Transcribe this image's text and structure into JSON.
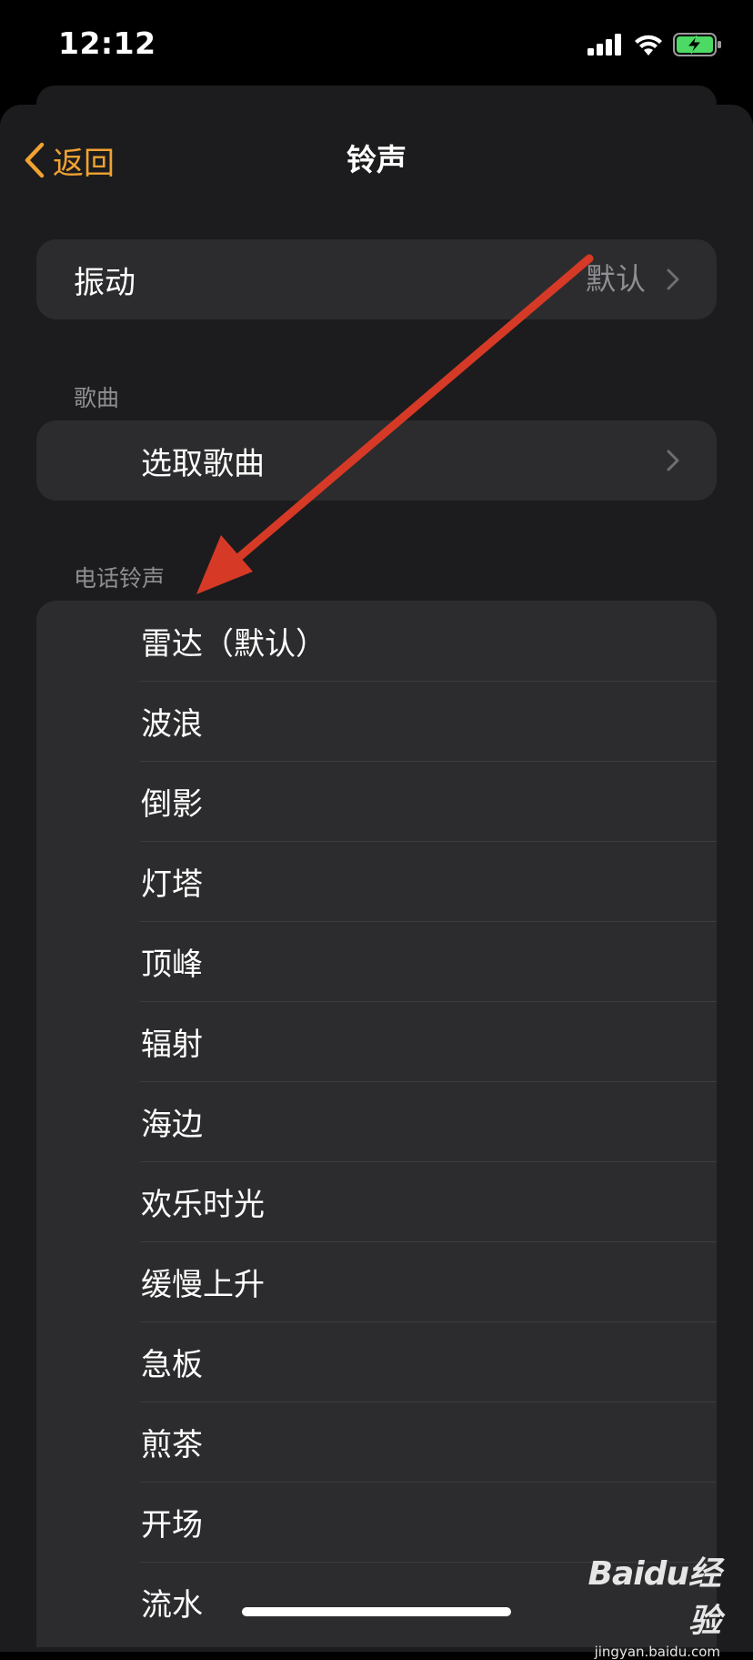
{
  "status_bar": {
    "time": "12:12",
    "signal_icon": "cellular-signal-icon",
    "wifi_icon": "wifi-icon",
    "battery_icon": "battery-charging-icon",
    "battery_color": "#4cd964"
  },
  "nav": {
    "back_label": "返回",
    "title": "铃声",
    "accent_color": "#f0a232"
  },
  "vibration": {
    "label": "振动",
    "value": "默认"
  },
  "songs_section": {
    "header": "歌曲",
    "pick_label": "选取歌曲"
  },
  "ringtones_section": {
    "header": "电话铃声",
    "items": [
      {
        "label": "雷达（默认）"
      },
      {
        "label": "波浪"
      },
      {
        "label": "倒影"
      },
      {
        "label": "灯塔"
      },
      {
        "label": "顶峰"
      },
      {
        "label": "辐射"
      },
      {
        "label": "海边"
      },
      {
        "label": "欢乐时光"
      },
      {
        "label": "缓慢上升"
      },
      {
        "label": "急板"
      },
      {
        "label": "煎茶"
      },
      {
        "label": "开场"
      },
      {
        "label": "流水"
      }
    ]
  },
  "annotation": {
    "arrow_color": "#d63a26"
  },
  "watermark": {
    "logo": "Baidu经验",
    "url": "jingyan.baidu.com"
  }
}
